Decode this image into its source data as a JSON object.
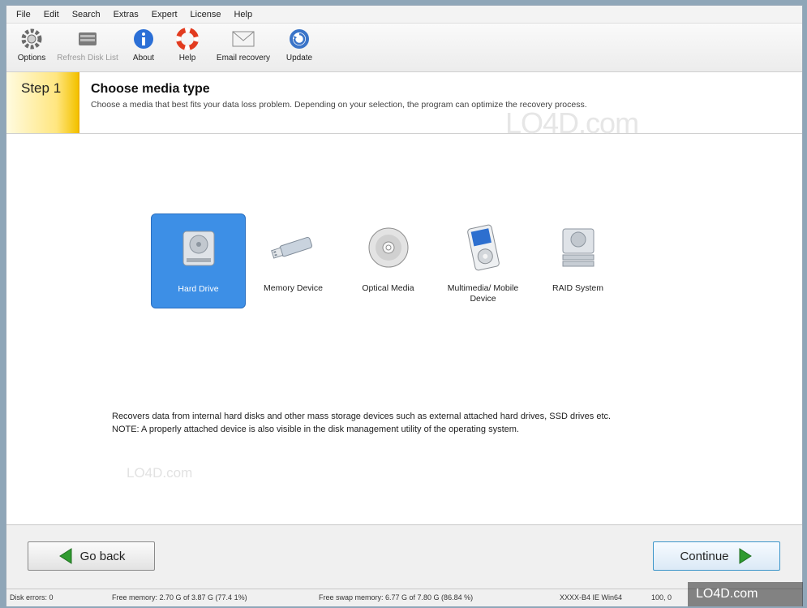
{
  "menu": [
    "File",
    "Edit",
    "Search",
    "Extras",
    "Expert",
    "License",
    "Help"
  ],
  "toolbar": [
    {
      "label": "Options",
      "icon": "gear-icon",
      "disabled": false
    },
    {
      "label": "Refresh Disk List",
      "icon": "disk-list-icon",
      "disabled": true
    },
    {
      "label": "About",
      "icon": "info-icon",
      "disabled": false
    },
    {
      "label": "Help",
      "icon": "lifebuoy-icon",
      "disabled": false
    },
    {
      "label": "Email recovery",
      "icon": "envelope-icon",
      "disabled": false
    },
    {
      "label": "Update",
      "icon": "update-icon",
      "disabled": false
    }
  ],
  "step": {
    "badge": "Step 1",
    "title": "Choose media type",
    "description": "Choose a media that best fits your data loss problem. Depending on your selection, the program can optimize the recovery process."
  },
  "media": [
    {
      "label": "Hard Drive",
      "icon": "hard-drive-icon",
      "selected": true
    },
    {
      "label": "Memory Device",
      "icon": "usb-stick-icon",
      "selected": false
    },
    {
      "label": "Optical Media",
      "icon": "optical-disc-icon",
      "selected": false
    },
    {
      "label": "Multimedia/ Mobile Device",
      "icon": "media-player-icon",
      "selected": false
    },
    {
      "label": "RAID System",
      "icon": "raid-icon",
      "selected": false
    }
  ],
  "media_description": {
    "line1": "Recovers data from internal hard disks and other mass storage devices such as external attached hard drives, SSD drives etc.",
    "line2": "NOTE: A properly attached device is also visible in the disk management utility of the operating system."
  },
  "watermark": "LO4D.com",
  "buttons": {
    "back": "Go back",
    "continue": "Continue"
  },
  "status": {
    "disk_errors": "Disk errors: 0",
    "free_memory": "Free memory: 2.70 G of 3.87 G (77.4 1%)",
    "free_swap": "Free swap memory: 6.77 G of 7.80 G (86.84 %)",
    "build": "XXXX-B4 IE Win64",
    "position": "100, 0"
  },
  "colors": {
    "accent": "#3d8fe6",
    "step_badge": "#ffe680",
    "back_arrow": "#2f9b2f",
    "continue_arrow": "#2f9b2f"
  }
}
